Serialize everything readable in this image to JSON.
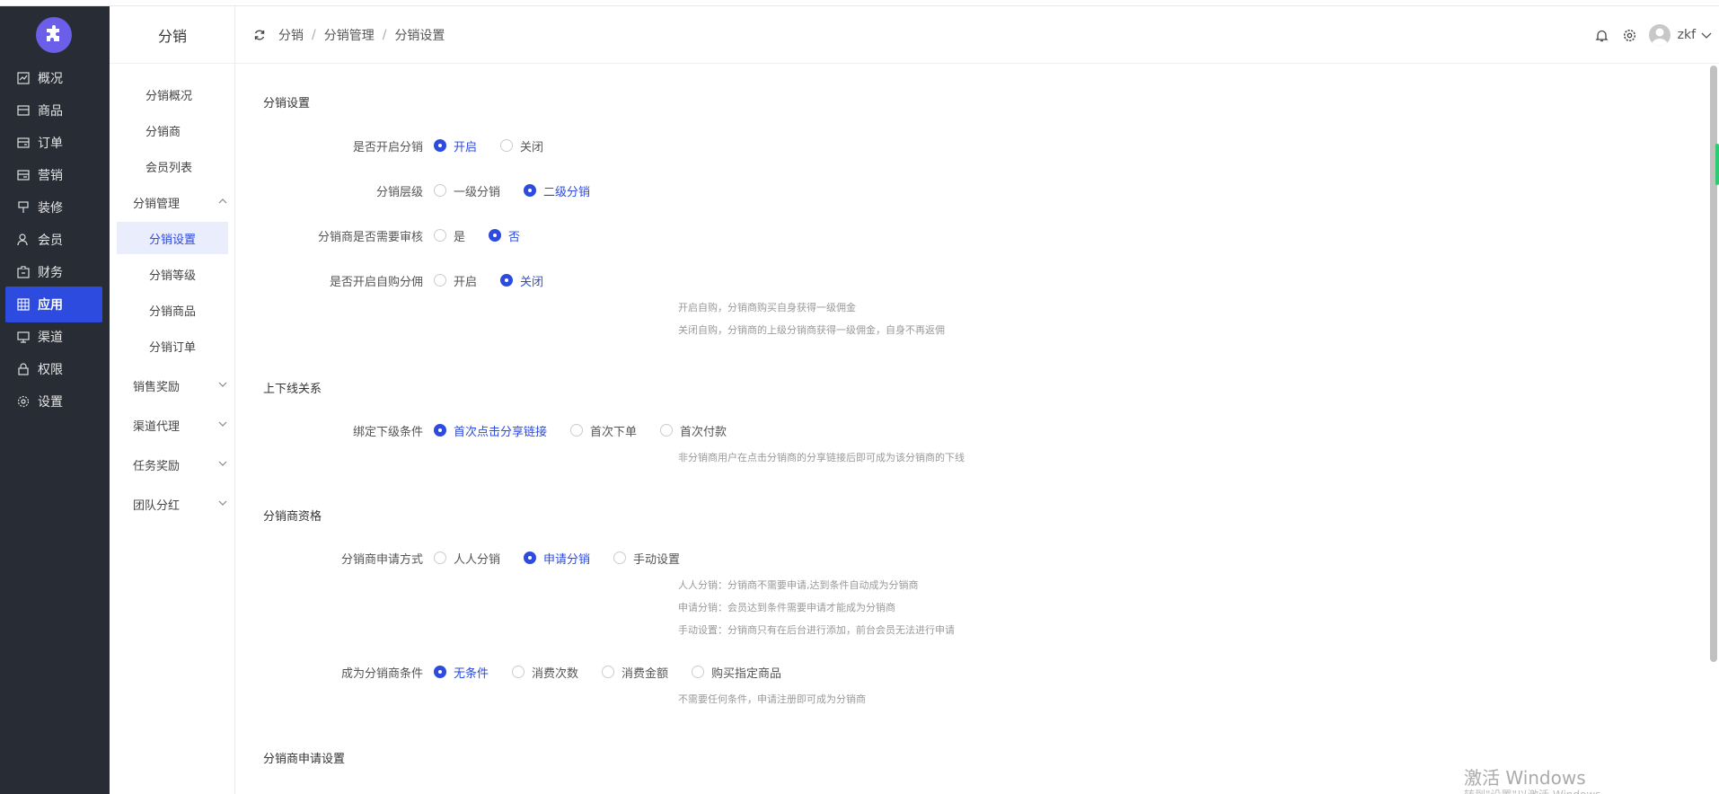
{
  "sidebar": {
    "items": [
      {
        "label": "概况",
        "icon": "chart-icon"
      },
      {
        "label": "商品",
        "icon": "goods-icon"
      },
      {
        "label": "订单",
        "icon": "order-icon"
      },
      {
        "label": "营销",
        "icon": "marketing-icon"
      },
      {
        "label": "装修",
        "icon": "decorate-icon"
      },
      {
        "label": "会员",
        "icon": "member-icon"
      },
      {
        "label": "财务",
        "icon": "finance-icon"
      },
      {
        "label": "应用",
        "icon": "apps-icon",
        "active": true
      },
      {
        "label": "渠道",
        "icon": "channel-icon"
      },
      {
        "label": "权限",
        "icon": "lock-icon"
      },
      {
        "label": "设置",
        "icon": "gear-icon"
      }
    ]
  },
  "submenu": {
    "title": "分销",
    "items": [
      "分销概况",
      "分销商",
      "会员列表"
    ],
    "group": "分销管理",
    "group_items": [
      "分销设置",
      "分销等级",
      "分销商品",
      "分销订单"
    ],
    "groups": [
      "销售奖励",
      "渠道代理",
      "任务奖励",
      "团队分红"
    ]
  },
  "breadcrumb": [
    "分销",
    "分销管理",
    "分销设置"
  ],
  "user": {
    "name": "zkf"
  },
  "sections": {
    "s1": "分销设置",
    "s2": "上下线关系",
    "s3": "分销商资格",
    "s4": "分销商申请设置"
  },
  "fields": {
    "enable": {
      "label": "是否开启分销",
      "options": [
        "开启",
        "关闭"
      ]
    },
    "level": {
      "label": "分销层级",
      "options": [
        "一级分销",
        "二级分销"
      ]
    },
    "audit": {
      "label": "分销商是否需要审核",
      "options": [
        "是",
        "否"
      ]
    },
    "selfbuy": {
      "label": "是否开启自购分佣",
      "options": [
        "开启",
        "关闭"
      ],
      "hints": [
        "开启自购，分销商购买自身获得一级佣金",
        "关闭自购，分销商的上级分销商获得一级佣金，自身不再返佣"
      ]
    },
    "bind": {
      "label": "绑定下级条件",
      "options": [
        "首次点击分享链接",
        "首次下单",
        "首次付款"
      ],
      "hints": [
        "非分销商用户在点击分销商的分享链接后即可成为该分销商的下线"
      ]
    },
    "apply": {
      "label": "分销商申请方式",
      "options": [
        "人人分销",
        "申请分销",
        "手动设置"
      ],
      "hints": [
        "人人分销：分销商不需要申请,达到条件自动成为分销商",
        "申请分销：会员达到条件需要申请才能成为分销商",
        "手动设置：分销商只有在后台进行添加，前台会员无法进行申请"
      ]
    },
    "cond": {
      "label": "成为分销商条件",
      "options": [
        "无条件",
        "消费次数",
        "消费金额",
        "购买指定商品"
      ],
      "hints": [
        "不需要任何条件，申请注册即可成为分销商"
      ]
    }
  },
  "watermark": "激活 Windows",
  "watermark_sub": "转到\"设置\"以激活 Windows。"
}
